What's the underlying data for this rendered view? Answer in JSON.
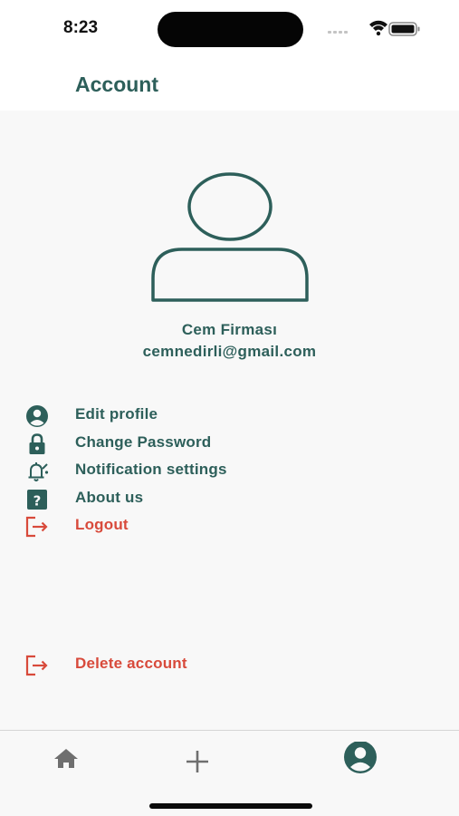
{
  "status_bar": {
    "time": "8:23"
  },
  "header": {
    "title": "Account"
  },
  "profile": {
    "name": "Cem Firması",
    "email": "cemnedirli@gmail.com"
  },
  "menu": {
    "edit_profile": "Edit profile",
    "change_password": "Change Password",
    "notification_settings": "Notification settings",
    "about_us": "About us",
    "logout": "Logout",
    "delete_account": "Delete account"
  },
  "icons": {
    "edit_profile": "account-circle-icon",
    "change_password": "lock-icon",
    "notification_settings": "bell-settings-icon",
    "about_us": "help-box-icon",
    "logout": "logout-icon",
    "delete_account": "logout-icon",
    "tabs": [
      "home-icon",
      "plus-icon",
      "account-circle-icon"
    ]
  },
  "tab_bar": {
    "active_tab": "account"
  },
  "colors": {
    "primary": "#2d5f5a",
    "danger": "#d84a3b",
    "background": "#f8f8f8",
    "inactive_tab": "#6f6f6f"
  }
}
